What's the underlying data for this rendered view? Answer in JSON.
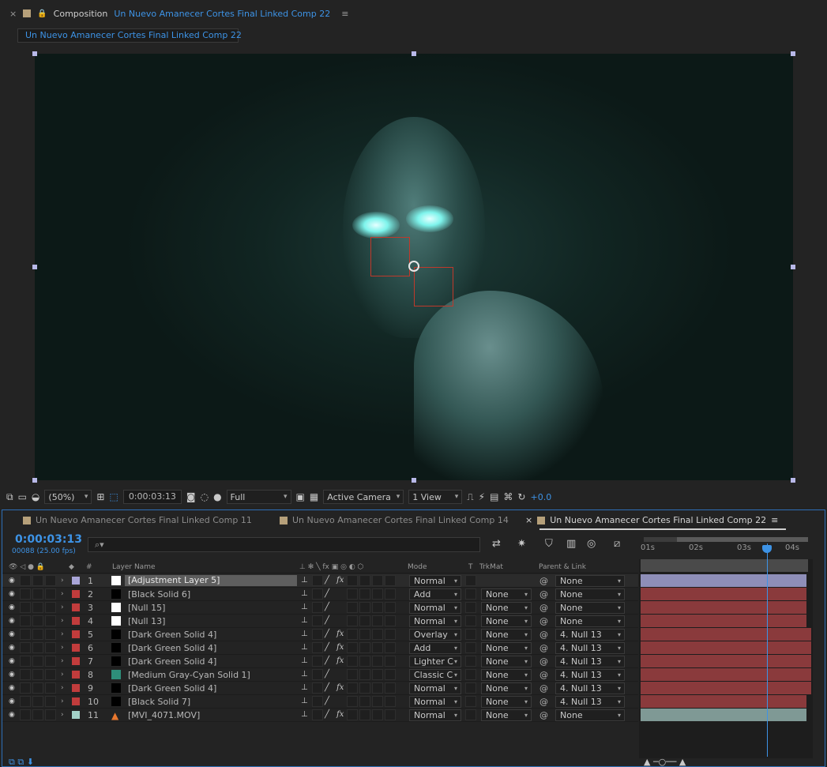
{
  "composition_panel": {
    "close_glyph": "×",
    "lock_glyph": "🔒",
    "title": "Composition",
    "comp_name": "Un Nuevo Amanecer Cortes Final Linked Comp 22",
    "menu_glyph": "≡",
    "sub_tab": "Un Nuevo Amanecer Cortes Final Linked Comp 22"
  },
  "viewer_footer": {
    "magnification": "(50%)",
    "timecode": "0:00:03:13",
    "resolution": "Full",
    "camera": "Active Camera",
    "views": "1 View",
    "exposure": "+0.0"
  },
  "timeline": {
    "tabs": [
      {
        "label": "Un Nuevo Amanecer Cortes Final Linked Comp 11"
      },
      {
        "label": "Un Nuevo Amanecer Cortes Final Linked Comp 14"
      },
      {
        "label": "Un Nuevo Amanecer Cortes Final Linked Comp 22"
      }
    ],
    "tab_close": "×",
    "tab_menu": "≡",
    "current_time": "0:00:03:13",
    "frames": "00088 (25.00 fps)",
    "search_icon": "⌕▾",
    "ruler_ticks": [
      "01s",
      "02s",
      "03s",
      "04s"
    ],
    "columns": {
      "hash": "#",
      "layer_name": "Layer Name",
      "mode": "Mode",
      "t": "T",
      "trkmat": "TrkMat",
      "parent": "Parent & Link"
    },
    "layers": [
      {
        "num": "1",
        "name": "[Adjustment Layer 5]",
        "label_color": "#a9a5d8",
        "type_color": "#ffffff",
        "fx": "fx",
        "mode": "Normal",
        "trkmat": "",
        "parent": "None",
        "clip_color": "#8e8eb8"
      },
      {
        "num": "2",
        "name": "[Black Solid 6]",
        "label_color": "#c13c3c",
        "type_color": "#000000",
        "fx": "",
        "mode": "Add",
        "trkmat": "None",
        "parent": "None",
        "clip_color": "#8a3a3c"
      },
      {
        "num": "3",
        "name": "[Null 15]",
        "label_color": "#c13c3c",
        "type_color": "#ffffff",
        "fx": "",
        "mode": "Normal",
        "trkmat": "None",
        "parent": "None",
        "clip_color": "#8a3a3c"
      },
      {
        "num": "4",
        "name": "[Null 13]",
        "label_color": "#c13c3c",
        "type_color": "#ffffff",
        "fx": "",
        "mode": "Normal",
        "trkmat": "None",
        "parent": "None",
        "clip_color": "#8a3a3c"
      },
      {
        "num": "5",
        "name": "[Dark Green Solid 4]",
        "label_color": "#c13c3c",
        "type_color": "#000000",
        "fx": "fx",
        "mode": "Overlay",
        "trkmat": "None",
        "parent": "4. Null 13",
        "clip_color": "#8a3a3c"
      },
      {
        "num": "6",
        "name": "[Dark Green Solid 4]",
        "label_color": "#c13c3c",
        "type_color": "#000000",
        "fx": "fx",
        "mode": "Add",
        "trkmat": "None",
        "parent": "4. Null 13",
        "clip_color": "#8a3a3c"
      },
      {
        "num": "7",
        "name": "[Dark Green Solid 4]",
        "label_color": "#c13c3c",
        "type_color": "#000000",
        "fx": "fx",
        "mode": "Lighter C",
        "trkmat": "None",
        "parent": "4. Null 13",
        "clip_color": "#8a3a3c"
      },
      {
        "num": "8",
        "name": "[Medium Gray-Cyan Solid 1]",
        "label_color": "#c13c3c",
        "type_color": "#2e8f7a",
        "fx": "",
        "mode": "Classic C",
        "trkmat": "None",
        "parent": "4. Null 13",
        "clip_color": "#8a3a3c"
      },
      {
        "num": "9",
        "name": "[Dark Green Solid 4]",
        "label_color": "#c13c3c",
        "type_color": "#000000",
        "fx": "fx",
        "mode": "Normal",
        "trkmat": "None",
        "parent": "4. Null 13",
        "clip_color": "#8a3a3c"
      },
      {
        "num": "10",
        "name": "[Black Solid 7]",
        "label_color": "#c13c3c",
        "type_color": "#000000",
        "fx": "",
        "mode": "Normal",
        "trkmat": "None",
        "parent": "4. Null 13",
        "clip_color": "#8a3a3c"
      },
      {
        "num": "11",
        "name": "[MVI_4071.MOV]",
        "label_color": "#a3d2c8",
        "type_color": "#e8772e",
        "fx": "fx",
        "mode": "Normal",
        "trkmat": "None",
        "parent": "None",
        "clip_color": "#7f9995"
      }
    ]
  },
  "colors": {
    "accent": "#3d93e6",
    "panel_bg": "#232323",
    "null_box": "#c0392b"
  }
}
